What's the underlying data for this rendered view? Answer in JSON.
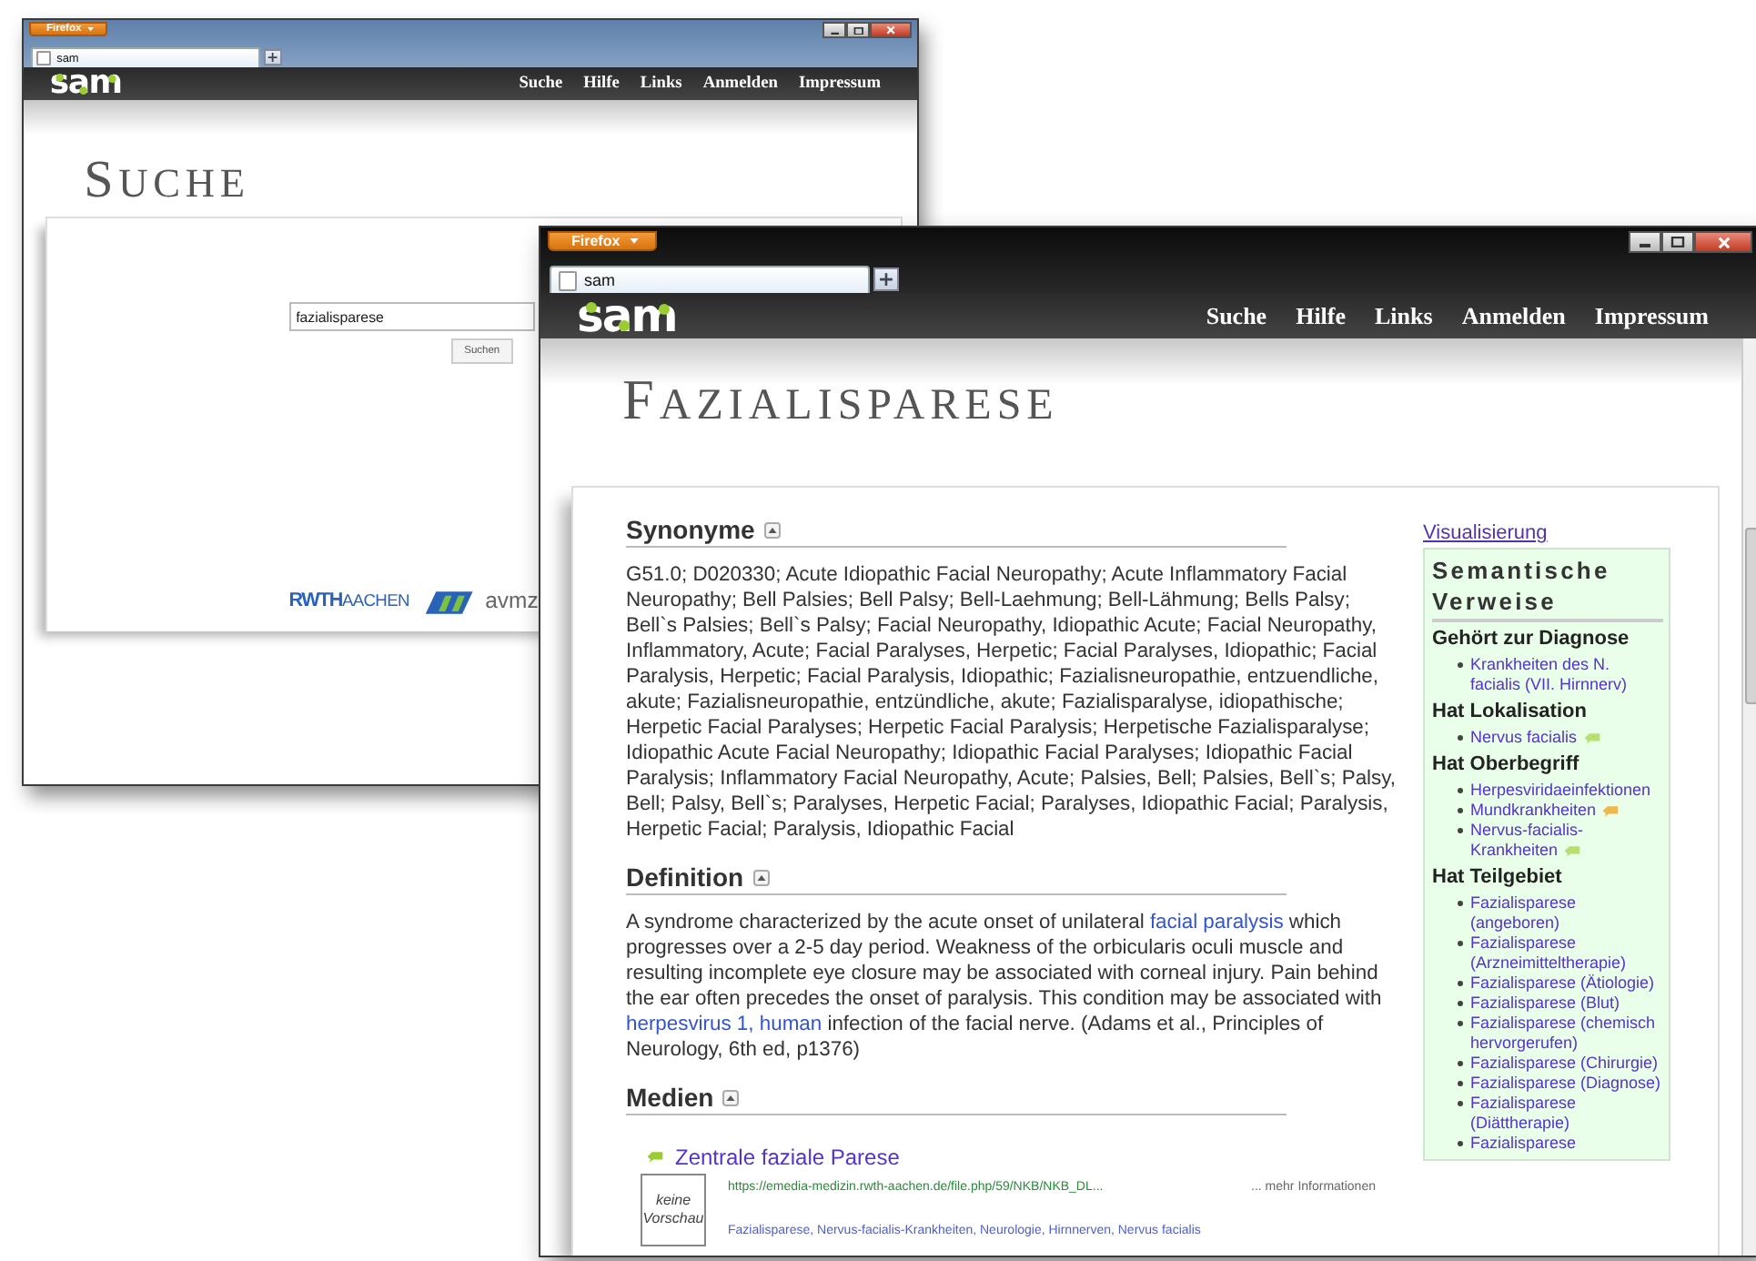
{
  "back_window": {
    "menu_button": "Firefox",
    "tab": "sam",
    "new_tab": "+",
    "logo": "sam",
    "nav": [
      "Suche",
      "Hilfe",
      "Links",
      "Anmelden",
      "Impressum"
    ],
    "title": "SUCHE",
    "search": {
      "value": "fazialisparese"
    },
    "search_button": "Suchen",
    "logos": {
      "rwth": "RWTH",
      "aachen": "AACHEN",
      "avmz": "avmz"
    }
  },
  "front_window": {
    "menu_button": "Firefox",
    "tab": "sam",
    "new_tab": "+",
    "logo": "sam",
    "nav": [
      "Suche",
      "Hilfe",
      "Links",
      "Anmelden",
      "Impressum"
    ],
    "title": "FAZIALISPARESE",
    "sections": [
      {
        "heading": "Synonyme",
        "kind": "text",
        "segments": [
          {
            "text": "G51.0; D020330; Acute Idiopathic Facial Neuropathy; Acute Inflammatory Facial Neuropathy; Bell Palsies; Bell Palsy; Bell-Laehmung; Bell-Lähmung; Bells Palsy; Bell`s Palsies; Bell`s Palsy; Facial Neuropathy, Idiopathic Acute; Facial Neuropathy, Inflammatory, Acute; Facial Paralyses, Herpetic; Facial Paralyses, Idiopathic; Facial Paralysis, Herpetic; Facial Paralysis, Idiopathic; Fazialisneuropathie, entzuendliche, akute; Fazialisneuropathie, entzündliche, akute; Fazialisparalyse, idiopathische; Herpetic Facial Paralyses; Herpetic Facial Paralysis; Herpetische Fazialisparalyse; Idiopathic Acute Facial Neuropathy; Idiopathic Facial Paralyses; Idiopathic Facial Paralysis; Inflammatory Facial Neuropathy, Acute; Palsies, Bell; Palsies, Bell`s; Palsy, Bell; Palsy, Bell`s; Paralyses, Herpetic Facial; Paralyses, Idiopathic Facial; Paralysis, Herpetic Facial; Paralysis, Idiopathic Facial",
            "link": false
          }
        ]
      },
      {
        "heading": "Definition",
        "kind": "text",
        "segments": [
          {
            "text": "A syndrome characterized by the acute onset of unilateral ",
            "link": false
          },
          {
            "text": "facial paralysis",
            "link": true
          },
          {
            "text": " which progresses over a 2-5 day period. Weakness of the orbicularis oculi muscle and resulting incomplete eye closure may be associated with corneal injury. Pain behind the ear often precedes the onset of paralysis. This condition may be associated with ",
            "link": false
          },
          {
            "text": "herpesvirus 1, human",
            "link": true
          },
          {
            "text": " infection of the facial nerve. (Adams et al., Principles of Neurology, 6th ed, p1376)",
            "link": false
          }
        ]
      },
      {
        "heading": "Medien",
        "kind": "media",
        "items": [
          {
            "title": "Zentrale faziale Parese",
            "thumbnail": "keine Vorschau",
            "url": "https://emedia-medizin.rwth-aachen.de/file.php/59/NKB/NKB_DL...",
            "more": "... mehr Informationen",
            "tags": "Fazialisparese, Nervus-facialis-Krankheiten, Neurologie, Hirnnerven, Nervus facialis"
          }
        ]
      }
    ],
    "sidebar": {
      "link": "Visualisierung",
      "title": "Semantische Verweise",
      "groups": [
        {
          "heading": "Gehört zur Diagnose",
          "items": [
            {
              "label": "Krankheiten des N. facialis (VII. Hirnnerv)"
            }
          ]
        },
        {
          "heading": "Hat Lokalisation",
          "items": [
            {
              "label": "Nervus facialis",
              "color": "#b8e070"
            }
          ]
        },
        {
          "heading": "Hat Oberbegriff",
          "items": [
            {
              "label": "Herpesviridaeinfektionen"
            },
            {
              "label": "Mundkrankheiten",
              "color": "#f0b84a"
            },
            {
              "label": "Nervus-facialis-Krankheiten",
              "color": "#b8e070"
            }
          ]
        },
        {
          "heading": "Hat Teilgebiet",
          "items": [
            {
              "label": "Fazialisparese (angeboren)"
            },
            {
              "label": "Fazialisparese (Arzneimitteltherapie)"
            },
            {
              "label": "Fazialisparese (Ätiologie)"
            },
            {
              "label": "Fazialisparese (Blut)"
            },
            {
              "label": "Fazialisparese (chemisch hervorgerufen)"
            },
            {
              "label": "Fazialisparese (Chirurgie)"
            },
            {
              "label": "Fazialisparese (Diagnose)"
            },
            {
              "label": "Fazialisparese (Diättherapie)"
            },
            {
              "label": "Fazialisparese"
            }
          ]
        }
      ]
    }
  }
}
